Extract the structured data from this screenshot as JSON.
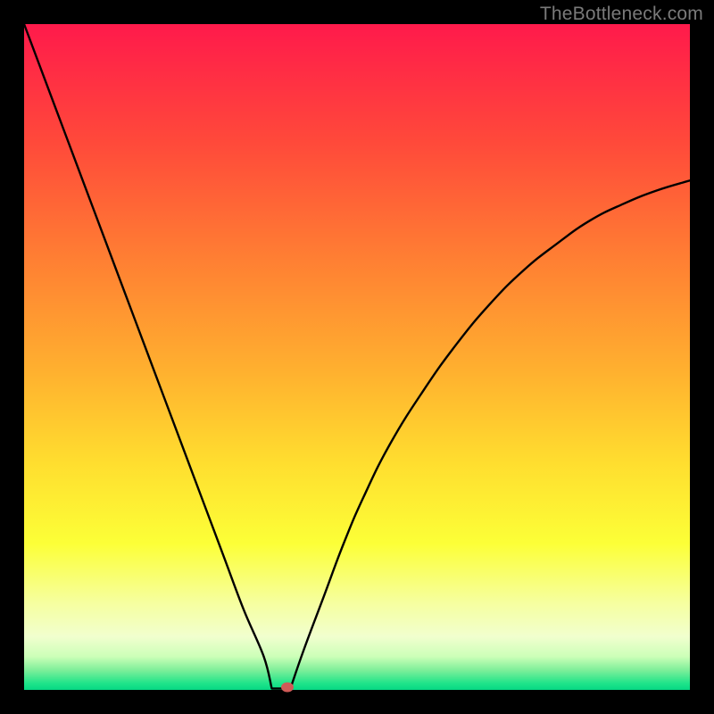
{
  "watermark": "TheBottleneck.com",
  "chart_data": {
    "type": "line",
    "title": "",
    "xlabel": "",
    "ylabel": "",
    "xlim": [
      0,
      100
    ],
    "ylim": [
      0,
      100
    ],
    "grid": false,
    "legend": false,
    "series": [
      {
        "name": "bottleneck-curve",
        "x": [
          0,
          3,
          6,
          9,
          12,
          15,
          18,
          21,
          24,
          27,
          30,
          33,
          36,
          37.5,
          38.5,
          39.5,
          42,
          45,
          48,
          51,
          55,
          60,
          65,
          70,
          75,
          80,
          85,
          90,
          95,
          100
        ],
        "values": [
          100,
          92,
          84,
          76,
          68,
          60,
          52,
          44,
          36,
          28,
          20,
          12,
          5,
          1,
          0.2,
          0.7,
          6,
          14,
          22,
          29,
          37,
          45,
          52,
          58,
          63,
          67,
          70.5,
          73,
          75,
          76.5
        ]
      }
    ],
    "flat_bottom": {
      "x_from": 37.2,
      "x_to": 40.0,
      "y": 0.2
    },
    "marker": {
      "x": 39.6,
      "y": 0.4,
      "color": "#d15a57"
    },
    "gradient_stops": [
      {
        "pos": 0,
        "color": "#ff1a4b"
      },
      {
        "pos": 18,
        "color": "#ff4a3a"
      },
      {
        "pos": 35,
        "color": "#ff7e33"
      },
      {
        "pos": 52,
        "color": "#ffb02f"
      },
      {
        "pos": 66,
        "color": "#ffde2f"
      },
      {
        "pos": 78,
        "color": "#fcff37"
      },
      {
        "pos": 87,
        "color": "#f6ffa0"
      },
      {
        "pos": 92,
        "color": "#f1ffce"
      },
      {
        "pos": 95,
        "color": "#ccffb8"
      },
      {
        "pos": 97,
        "color": "#7fef9a"
      },
      {
        "pos": 99,
        "color": "#1fe48a"
      },
      {
        "pos": 100,
        "color": "#07d884"
      }
    ]
  }
}
